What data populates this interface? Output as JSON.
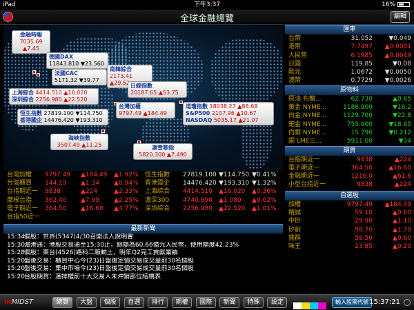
{
  "status": {
    "device": "iPad",
    "time": "下午3:37",
    "battery": "16%"
  },
  "header": {
    "title": "全球金融總覽",
    "edit_label": "編輯"
  },
  "map_boxes": {
    "jinrong": {
      "name": "金融時報",
      "price": "7035.69",
      "chg": "▲7.45"
    },
    "dax": {
      "name": "德國DAX",
      "price": "11843.810",
      "chg": "▼23.560"
    },
    "cac": {
      "name": "法國CAC",
      "price": "5171.32",
      "chg": "▼39.77"
    },
    "shanghai": {
      "name": "上海綜合",
      "price": "4414.510",
      "chg": "▲16.020"
    },
    "shenzhen": {
      "name": "深圳綜合",
      "price": "2256.980",
      "chg": "▲22.520"
    },
    "hangseng": {
      "name": "恆生指數",
      "price": "27819.100",
      "chg": "▼114.750"
    },
    "hkstate": {
      "name": "香港國企",
      "price": "14476.420",
      "chg": "▼193.310"
    },
    "korea": {
      "name": "南韓綜合",
      "price": "2173.41",
      "chg": "▲29.52"
    },
    "nikkei": {
      "name": "日經指數",
      "price": "20187.65",
      "chg": "▲53.75"
    },
    "taiwan": {
      "name": "台灣加權",
      "price": "9797.49",
      "chg": "▲184.49"
    },
    "dow": {
      "name": "道瓊指數",
      "price": "18038.27",
      "chg": "▲88.68"
    },
    "sp": {
      "name": "S&P500",
      "price": "2107.96",
      "chg": "▲10.67"
    },
    "nasdaq": {
      "name": "NASDAQ",
      "price": "5035.17",
      "chg": "▲21.07"
    },
    "straits": {
      "name": "海峽指數",
      "price": "3507.49",
      "chg": "▲11.25"
    },
    "aus": {
      "name": "澳雪黎指",
      "price": "5820.300",
      "chg": "▲7.490"
    }
  },
  "fx": {
    "title": "匯率",
    "rows": [
      {
        "n": "台幣",
        "v": "31.052",
        "c": "▼0.049"
      },
      {
        "n": "港幣",
        "v": "7.7497",
        "c": "▲0.0001"
      },
      {
        "n": "人民幣",
        "v": "6.1985",
        "c": "▲0.0049"
      },
      {
        "n": "日圓",
        "v": "119.85",
        "c": "▼0.08"
      },
      {
        "n": "歐元",
        "v": "1.0672",
        "c": "▼0.0050"
      },
      {
        "n": "澳幣",
        "v": "0.7729",
        "c": "▼0.0026"
      }
    ]
  },
  "raw": {
    "title": "原物料",
    "rows": [
      {
        "n": "原油 布蘭...",
        "v": "62.730",
        "c": "▲0.65"
      },
      {
        "n": "黃金 NYME...",
        "v": "1186.900",
        "c": "▼16.2"
      },
      {
        "n": "白金 NYME...",
        "v": "1129.700",
        "c": "▼22.8"
      },
      {
        "n": "鈀金 NYME...",
        "v": "755.900",
        "c": "▼18.65"
      },
      {
        "n": "白銀 NYME...",
        "v": "15.796",
        "c": "▼0.212"
      },
      {
        "n": "銅 LME三...",
        "v": "5911.00",
        "c": "▼34"
      }
    ]
  },
  "fut": {
    "title": "期貨",
    "rows": [
      {
        "n": "台指期近一",
        "v": "9838",
        "c": "▲224"
      },
      {
        "n": "電子期近一",
        "v": "364.50",
        "c": "▲16.60"
      },
      {
        "n": "金融期近一",
        "v": "1216.0",
        "c": "▲61.6"
      },
      {
        "n": "小型台指近一",
        "v": "9838",
        "c": "▲224"
      }
    ]
  },
  "self": {
    "title": "自選股",
    "rows": [
      {
        "n": "加權",
        "v": "9797.49",
        "c": "▲184.49"
      },
      {
        "n": "精誠",
        "v": "59.10",
        "c": "▲0.60"
      },
      {
        "n": "中砂",
        "v": "29.90",
        "c": "▲1.10"
      },
      {
        "n": "矽創",
        "v": "98.70",
        "c": "▲1.70"
      },
      {
        "n": "盛群",
        "v": "58.50",
        "c": "▲0.60"
      },
      {
        "n": "味王",
        "v": "23.85",
        "c": "▲0.20"
      }
    ]
  },
  "mid_left": [
    {
      "n": "台灣加權",
      "v": "9797.49",
      "c": "▲184.49",
      "p": "▲1.92%"
    },
    {
      "n": "台灣櫃買",
      "v": "144.19",
      "c": "▲1.34",
      "p": "▲0.94%"
    },
    {
      "n": "台指期近一",
      "v": "9838",
      "c": "▲224",
      "p": "▲2.33%"
    },
    {
      "n": "摩根台指",
      "v": "362.40",
      "c": "▲7.99",
      "p": "▲2.25%"
    },
    {
      "n": "電子期近一",
      "v": "364.50",
      "c": "▲16.60",
      "p": "▲4.77%"
    },
    {
      "n": "台指50近一",
      "v": "",
      "c": "",
      "p": ""
    }
  ],
  "mid_right": [
    {
      "n": "恆生指數",
      "v": "27819.100",
      "c": "▼114.750",
      "p": "▼0.41%"
    },
    {
      "n": "香港國企",
      "v": "14476.420",
      "c": "▼193.310",
      "p": "▼1.32%"
    },
    {
      "n": "上海綜合",
      "v": "4414.510",
      "c": "▲16.020",
      "p": "▲0.36%"
    },
    {
      "n": "滬深300",
      "v": "4740.890",
      "c": "▲1.080",
      "p": "▲0.02%"
    },
    {
      "n": "深圳綜合",
      "v": "2256.980",
      "c": "▲22.520",
      "p": "▲1.01%"
    },
    {
      "n": "",
      "v": "",
      "c": "",
      "p": ""
    }
  ],
  "news": {
    "title": "最新新聞",
    "rows": [
      {
        "t": "15:34",
        "x": "個股：世界(5347)4/30召開法人說明會"
      },
      {
        "t": "15:30",
        "x": "滬港通：港股交易通至15:30止，餘額為60.66億元人民幣，使用額度42.23%"
      },
      {
        "t": "15:28",
        "x": "個股：東台(4526)路科二廠動土，明年Q2完工貢獻業績"
      },
      {
        "t": "15:20",
        "x": "盤後交易：櫃買中心今(23)日盤後定價交易成交量前30名個股"
      },
      {
        "t": "15:20",
        "x": "盤後交易：集中市場今(23)日盤後定價交易成交量前30名個股"
      },
      {
        "t": "15:20",
        "x": "台股期貨：選擇權前十大交易人未沖銷部位結構表"
      }
    ]
  },
  "bottom": {
    "logo": "MIDST",
    "tabs": [
      "總覽",
      "大盤",
      "個股",
      "自選",
      "排行",
      "期權",
      "國際",
      "新聞",
      "特殊",
      "設定"
    ],
    "input_label": "輸入股票代號",
    "clock": "15:37:21"
  },
  "colors": {
    "up": "#ff3333",
    "down": "#dddddd",
    "green": "#22cc22",
    "name_gold": "#c8a000",
    "header_blue": "#2c5a8c"
  }
}
